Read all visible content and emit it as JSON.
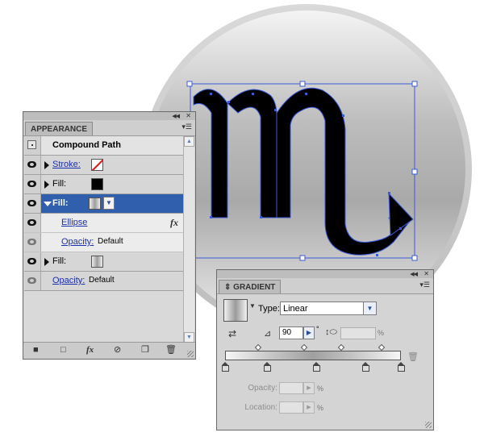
{
  "appearance": {
    "tab_label": "APPEARANCE",
    "header_title": "Compound Path",
    "rows": [
      {
        "label": "Stroke:"
      },
      {
        "label": "Fill:"
      },
      {
        "label": "Fill:"
      },
      {
        "label": "Ellipse"
      },
      {
        "label": "Opacity:",
        "value": "Default"
      },
      {
        "label": "Fill:"
      },
      {
        "label": "Opacity:",
        "value": "Default"
      }
    ],
    "fx_label": "fx",
    "icons": [
      "new-art-icon",
      "clear-icon",
      "add-effect-icon",
      "reduce-icon",
      "duplicate-icon",
      "delete-icon"
    ]
  },
  "gradient": {
    "tab_label": "GRADIENT",
    "type_label": "Type:",
    "type_value": "Linear",
    "angle_value": "90",
    "degree_symbol": "°",
    "percent": "%",
    "opacity_label": "Opacity:",
    "location_label": "Location:",
    "midpoint_percents": [
      19,
      45,
      66,
      89
    ],
    "stop_percents": [
      0,
      24,
      52,
      80,
      100
    ]
  },
  "colors": {
    "selection_blue": "#2f5fad",
    "path_blue": "#3a5bd9",
    "link_blue": "#1a2fb0"
  }
}
